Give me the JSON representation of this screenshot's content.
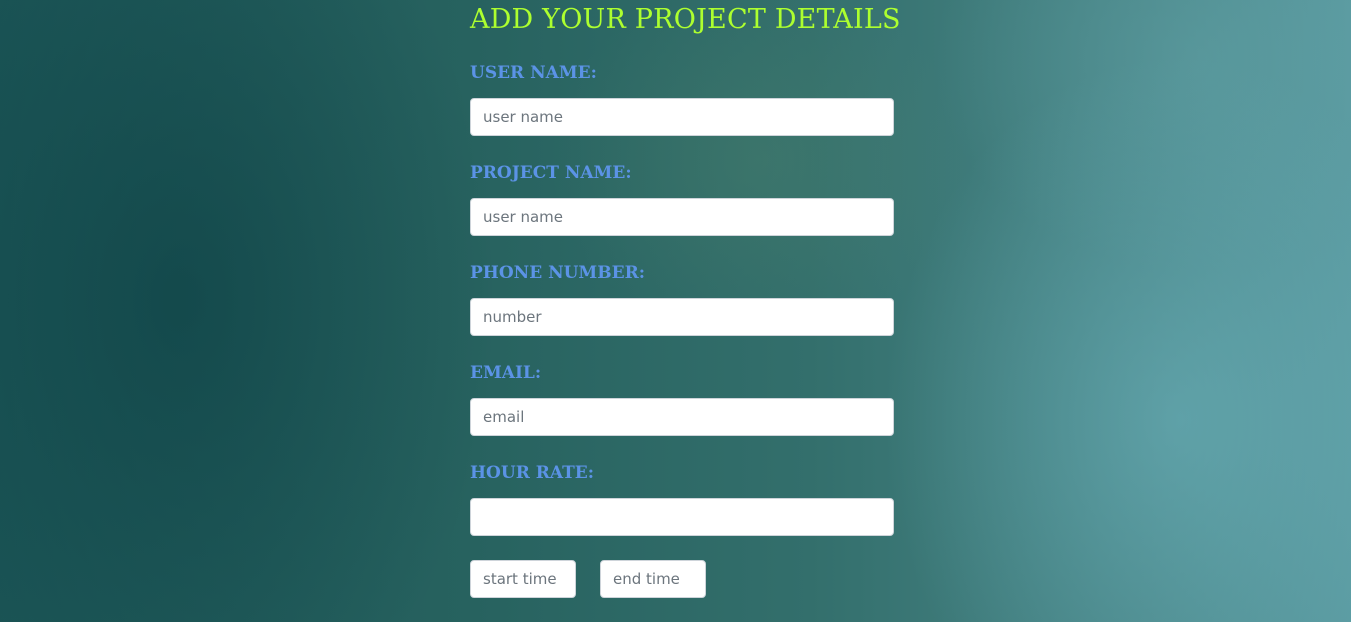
{
  "form": {
    "title": "ADD YOUR PROJECT DETAILS",
    "fields": [
      {
        "label": "USER NAME:",
        "placeholder": "user name",
        "value": ""
      },
      {
        "label": "PROJECT NAME:",
        "placeholder": "user name",
        "value": ""
      },
      {
        "label": "PHONE NUMBER:",
        "placeholder": "number",
        "value": ""
      },
      {
        "label": "EMAIL:",
        "placeholder": "email",
        "value": ""
      },
      {
        "label": "HOUR RATE:",
        "placeholder": "",
        "value": ""
      }
    ],
    "start_time": {
      "placeholder": "start time",
      "value": ""
    },
    "end_time": {
      "placeholder": "end time",
      "value": ""
    }
  },
  "colors": {
    "title": "#adff2f",
    "label": "#5b93e6",
    "background": "#2a6565"
  }
}
